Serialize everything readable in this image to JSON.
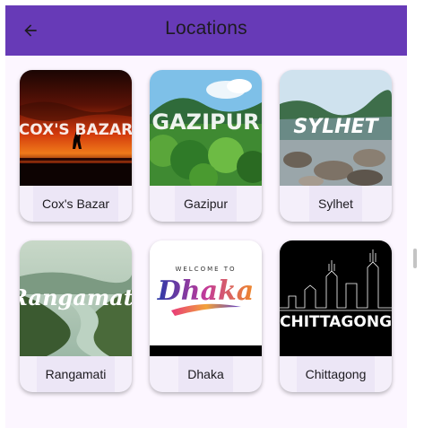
{
  "appbar": {
    "title": "Locations",
    "back_icon": "arrow-back-icon",
    "color": "#673ab7"
  },
  "locations": [
    {
      "label": "Cox's Bazar",
      "image_text": "COX'S BAZAR"
    },
    {
      "label": "Gazipur",
      "image_text": "GAZIPUR"
    },
    {
      "label": "Sylhet",
      "image_text": "SYLHET"
    },
    {
      "label": "Rangamati",
      "image_text": "Rangamati"
    },
    {
      "label": "Dhaka",
      "image_text": "Dhaka",
      "image_subtext": "WELCOME TO"
    },
    {
      "label": "Chittagong",
      "image_text": "CHITTAGONG"
    }
  ]
}
